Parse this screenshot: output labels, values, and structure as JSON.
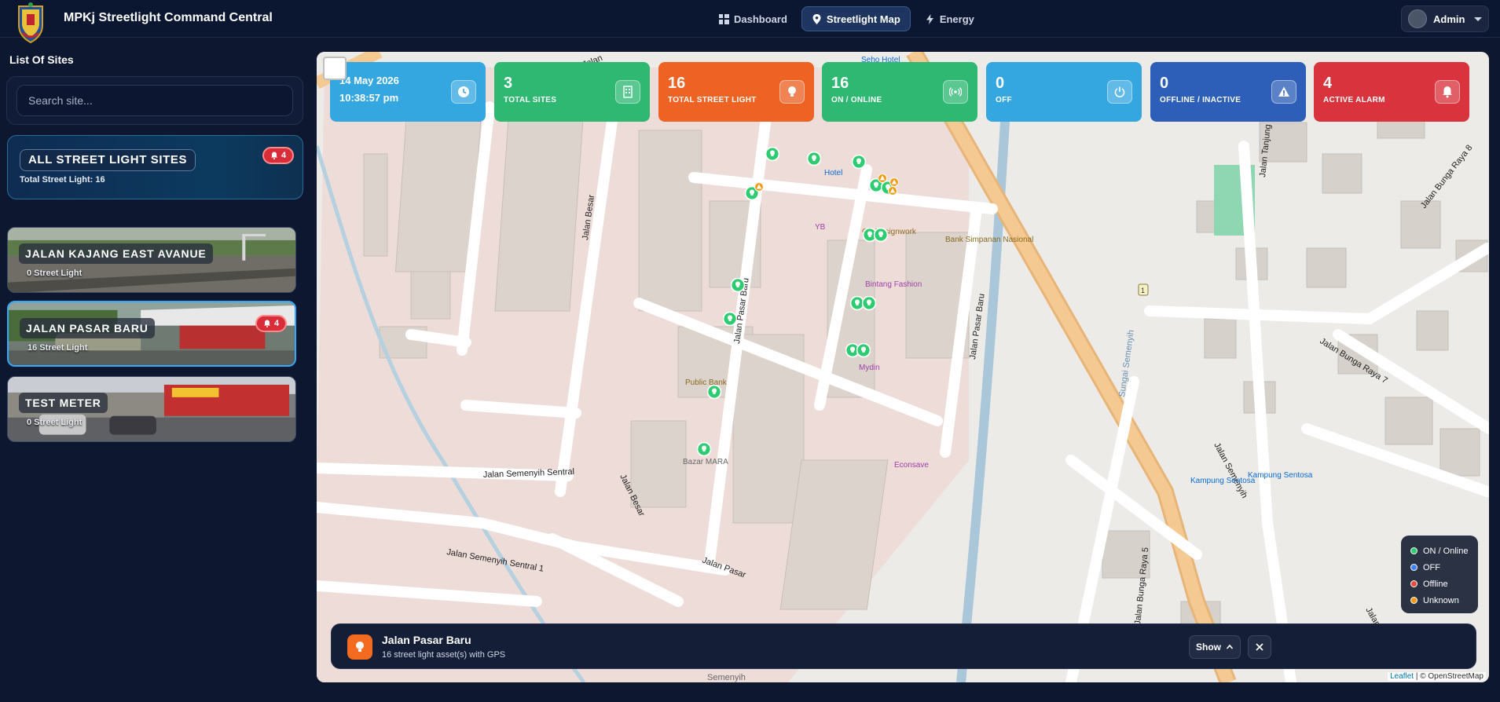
{
  "app": {
    "title": "MPKj Streetlight Command Central"
  },
  "nav": [
    {
      "label": "Dashboard"
    },
    {
      "label": "Streetlight Map",
      "active": true
    },
    {
      "label": "Energy"
    }
  ],
  "user": {
    "name": "Admin"
  },
  "sidebar": {
    "title": "List Of Sites",
    "search_placeholder": "Search site...",
    "all_sites": {
      "label": "ALL STREET LIGHT SITES",
      "subtitle": "Total Street Light: 16",
      "alarm_count": "4"
    },
    "sites": [
      {
        "name": "JALAN KAJANG EAST AVANUE",
        "subtitle": "0 Street Light",
        "alarm_count": ""
      },
      {
        "name": "JALAN PASAR BARU",
        "subtitle": "16 Street Light",
        "alarm_count": "4",
        "selected": true
      },
      {
        "name": "TEST METER",
        "subtitle": "0 Street Light",
        "alarm_count": ""
      }
    ]
  },
  "stats": {
    "datetime": {
      "date": "14 May 2026",
      "time": "10:38:57 pm",
      "color": "#35a7e0"
    },
    "total_sites": {
      "value": "3",
      "label": "TOTAL SITES",
      "color": "#2eb872"
    },
    "total_street_light": {
      "value": "16",
      "label": "TOTAL STREET LIGHT",
      "color": "#ee6224"
    },
    "online": {
      "value": "16",
      "label": "ON / ONLINE",
      "color": "#2eb872"
    },
    "off": {
      "value": "0",
      "label": "OFF",
      "color": "#35a7e0"
    },
    "offline": {
      "value": "0",
      "label": "OFFLINE / INACTIVE",
      "color": "#2e5fb8"
    },
    "alarm": {
      "value": "4",
      "label": "ACTIVE ALARM",
      "color": "#d9343d"
    }
  },
  "map": {
    "street_labels": [
      "Jalan Besar",
      "Jalan Pasar Baru",
      "Jalan Semenyih Sentral",
      "Jalan Semenyih Sentral 1",
      "Jalan Pasar",
      "Jalan Semenyih",
      "Jalan Tanjung",
      "Jalan Bunga Raya 7",
      "Jalan Bunga Raya 8",
      "Jalan Bunga Raya 5",
      "Sungai Semenyih",
      "Jalan Besar",
      "Jalan Pasar Baru",
      "Semenyih",
      "Jalan",
      "Jalan"
    ],
    "poi_labels": [
      "Hotel",
      "YB",
      "CE Designwork",
      "Bank Simpanan Nasional",
      "Bintang Fashion",
      "Mydin",
      "Public Bank",
      "Bazar MARA",
      "Econsave",
      "Kampung Sentosa",
      "Kampung Sentosa",
      "Seho Hotel"
    ],
    "legend": [
      {
        "label": "ON / Online",
        "color": "#2ecc71"
      },
      {
        "label": "OFF",
        "color": "#3b82f6"
      },
      {
        "label": "Offline",
        "color": "#e74c3c"
      },
      {
        "label": "Unknown",
        "color": "#f39c12"
      }
    ],
    "attribution": {
      "leaflet": "Leaflet",
      "rest": "| © OpenStreetMap"
    }
  },
  "info_panel": {
    "title": "Jalan Pasar Baru",
    "subtitle": "16 street light asset(s) with GPS",
    "show_label": "Show"
  }
}
